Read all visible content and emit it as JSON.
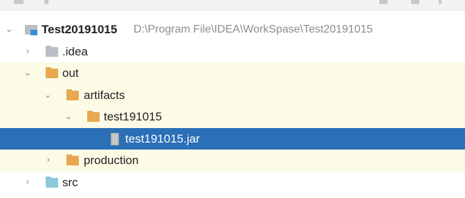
{
  "tree": {
    "root": {
      "label": "Test20191015",
      "path": "D:\\Program File\\IDEA\\WorkSpase\\Test20191015",
      "icon": "module-folder-icon"
    },
    "nodes": {
      "idea": {
        "label": ".idea",
        "icon": "folder-icon"
      },
      "out": {
        "label": "out",
        "icon": "folder-icon"
      },
      "artifacts": {
        "label": "artifacts",
        "icon": "folder-icon"
      },
      "test191015_folder": {
        "label": "test191015",
        "icon": "folder-icon"
      },
      "jar": {
        "label": "test191015.jar",
        "icon": "jar-file-icon"
      },
      "production": {
        "label": "production",
        "icon": "folder-icon"
      },
      "src": {
        "label": "src",
        "icon": "source-folder-icon"
      }
    }
  },
  "colors": {
    "selection": "#2b6fb7",
    "highlight": "#fcfbe6",
    "folder_excluded": "#e8a852",
    "folder_plain": "#b9bec4",
    "folder_source": "#8cc8dc",
    "path_text": "#8c8c8c"
  }
}
